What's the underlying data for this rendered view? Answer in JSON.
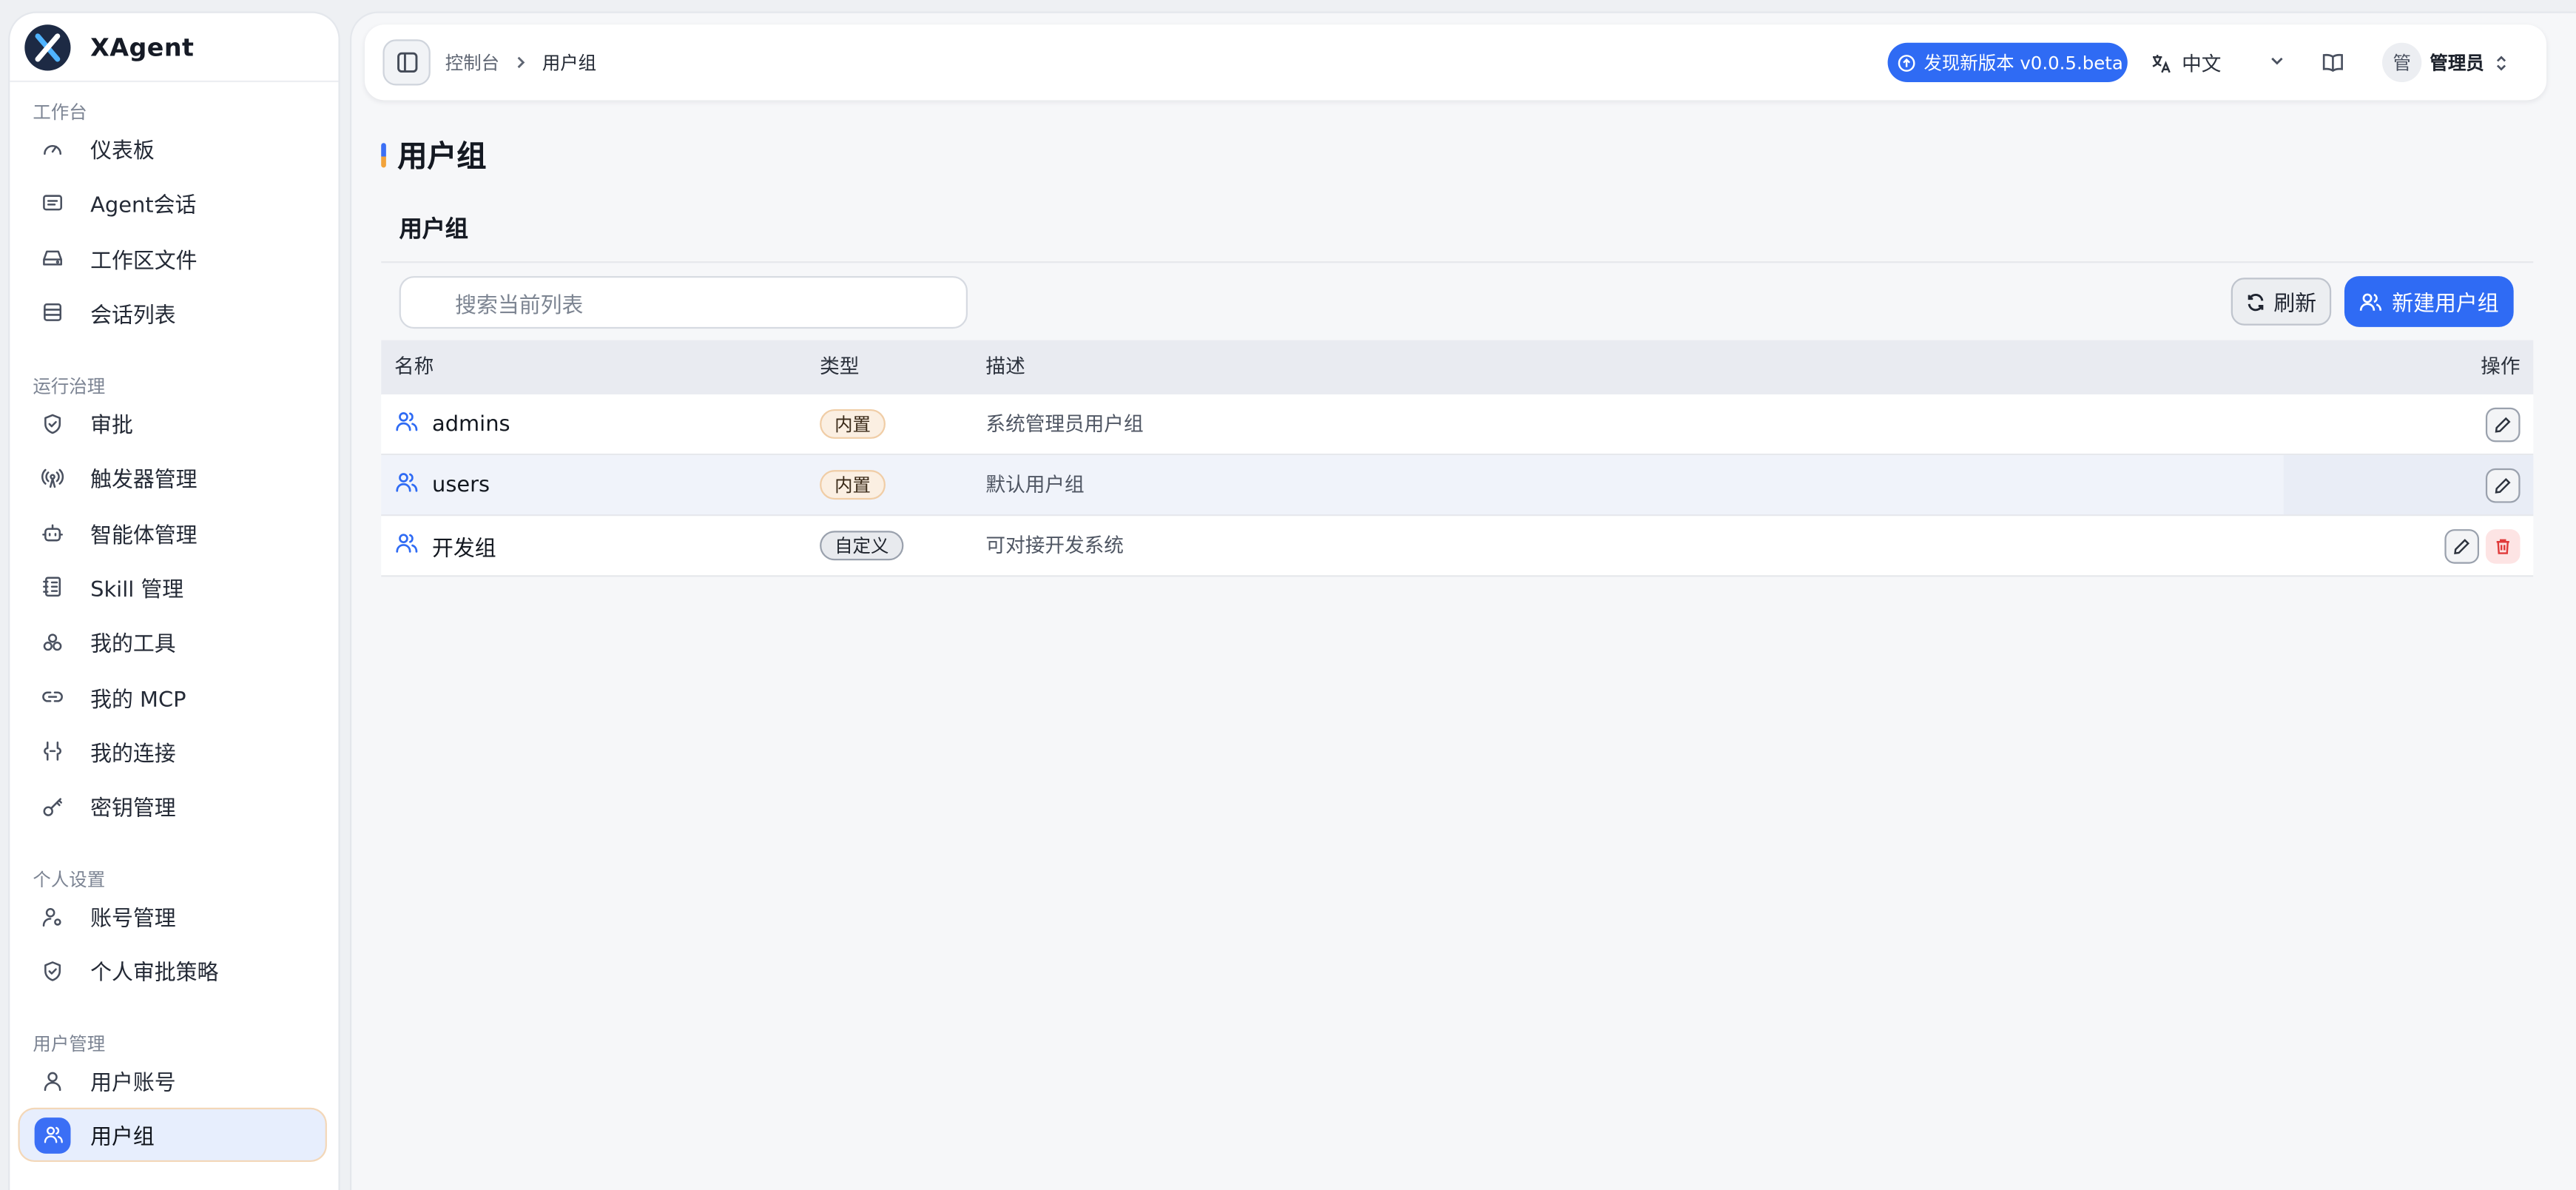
{
  "app": {
    "name": "XAgent"
  },
  "sidebar": {
    "sections": [
      {
        "title": "工作台",
        "items": [
          {
            "label": "仪表板",
            "icon": "gauge-icon"
          },
          {
            "label": "Agent会话",
            "icon": "message-square-icon"
          },
          {
            "label": "工作区文件",
            "icon": "hard-drive-icon"
          },
          {
            "label": "会话列表",
            "icon": "list-icon"
          }
        ]
      },
      {
        "title": "运行治理",
        "items": [
          {
            "label": "审批",
            "icon": "shield-check-icon"
          },
          {
            "label": "触发器管理",
            "icon": "radio-tower-icon"
          },
          {
            "label": "智能体管理",
            "icon": "bot-icon"
          },
          {
            "label": "Skill 管理",
            "icon": "notebook-icon"
          },
          {
            "label": "我的工具",
            "icon": "boxes-icon"
          },
          {
            "label": "我的 MCP",
            "icon": "link-icon"
          },
          {
            "label": "我的连接",
            "icon": "plug-icon"
          },
          {
            "label": "密钥管理",
            "icon": "key-icon"
          }
        ]
      },
      {
        "title": "个人设置",
        "items": [
          {
            "label": "账号管理",
            "icon": "user-cog-icon"
          },
          {
            "label": "个人审批策略",
            "icon": "shield-check-icon"
          }
        ]
      },
      {
        "title": "用户管理",
        "items": [
          {
            "label": "用户账号",
            "icon": "user-icon"
          },
          {
            "label": "用户组",
            "icon": "users-icon",
            "active": true
          }
        ]
      }
    ]
  },
  "topbar": {
    "breadcrumb": [
      "控制台",
      "用户组"
    ],
    "new_version": "发现新版本 v0.0.5.beta",
    "language": "中文",
    "user_avatar": "管",
    "user_name": "管理员"
  },
  "page": {
    "title": "用户组",
    "card_title": "用户组",
    "search_placeholder": "搜索当前列表",
    "refresh_label": "刷新",
    "create_label": "新建用户组",
    "columns": {
      "name": "名称",
      "type": "类型",
      "desc": "描述",
      "actions": "操作"
    },
    "rows": [
      {
        "name": "admins",
        "type": "内置",
        "type_kind": "builtin",
        "desc": "系统管理员用户组",
        "deletable": false
      },
      {
        "name": "users",
        "type": "内置",
        "type_kind": "builtin",
        "desc": "默认用户组",
        "deletable": false,
        "hovered": true
      },
      {
        "name": "开发组",
        "type": "自定义",
        "type_kind": "custom",
        "desc": "可对接开发系统",
        "deletable": true
      }
    ]
  },
  "colors": {
    "accent": "#2f6bf4",
    "delete": "#e03a3a",
    "builtin_tag": "#fbefe2"
  }
}
